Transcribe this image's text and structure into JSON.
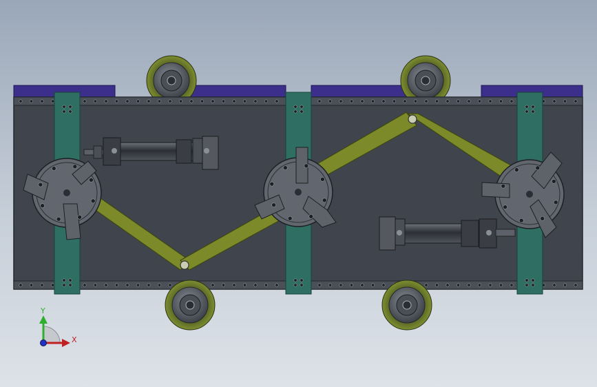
{
  "viewport": {
    "background_top": "#9aa7b8",
    "background_bottom": "#dde2e8"
  },
  "model": {
    "colors": {
      "frame": "#3f444d",
      "frame_edge": "#22262c",
      "rail": "#4b5058",
      "column": "#2f6e62",
      "column_edge": "#17423b",
      "top_plate": "#3c2f8c",
      "linkage": "#7c8a2a",
      "linkage_edge": "#3d4614",
      "wheel_tire": "#6a7a2a",
      "wheel_hub": "#555a62",
      "cylinder": "#3a3d44",
      "hub_disc": "#62676f",
      "bolt": "#1c1f24"
    }
  },
  "triad": {
    "y_label": "Y",
    "x_label": "X",
    "y_color": "#2fae2f",
    "x_color": "#c02020",
    "z_color": "#2030c8"
  }
}
